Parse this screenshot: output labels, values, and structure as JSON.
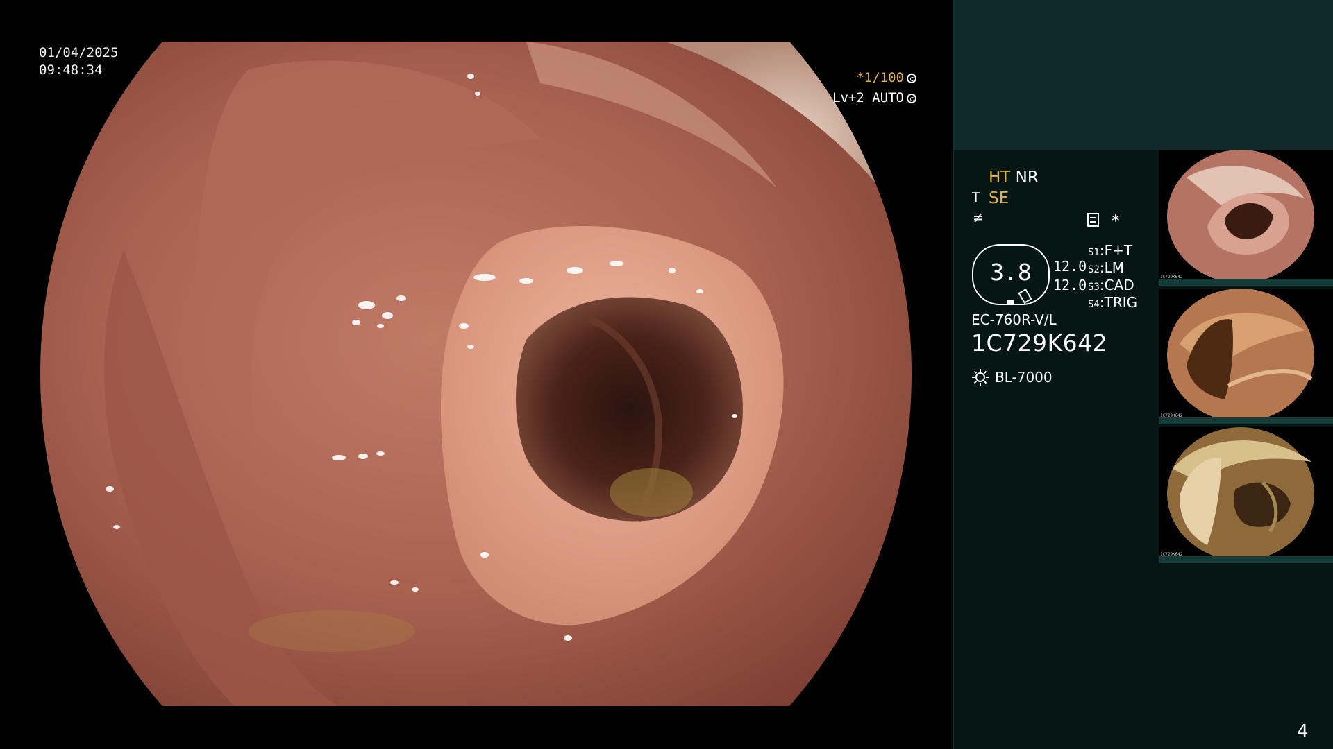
{
  "overlay": {
    "date": "01/04/2025",
    "time": "09:48:34",
    "shutter": "*1/100",
    "exposure_level": "Lv+2 AUTO"
  },
  "processing": {
    "ht": "HT",
    "nr": "NR",
    "se": "SE",
    "asterisk": "*"
  },
  "gauge": {
    "value": "3.8",
    "gain_top": "12.0",
    "gain_bottom": "12.0"
  },
  "switches": [
    {
      "key": "S1",
      "value": "F+T"
    },
    {
      "key": "S2",
      "value": "LM"
    },
    {
      "key": "S3",
      "value": "CAD"
    },
    {
      "key": "S4",
      "value": "TRIG"
    }
  ],
  "scope": {
    "model": "EC-760R-V/L",
    "serial": "1C729K642",
    "light_source": "BL-7000"
  },
  "thumbnails": [
    {
      "label": "1C729K642",
      "tone": "light"
    },
    {
      "label": "1C729K642",
      "tone": "mid"
    },
    {
      "label": "1C729K642",
      "tone": "yellow"
    }
  ],
  "page_number": "4",
  "colors": {
    "accent_orange": "#e5b040",
    "panel_top": "#0e2b2a",
    "panel_body": "#061615",
    "mucosa": "#b87260"
  },
  "icons": {
    "gauge": "lens-gauge-icon",
    "light": "sun-icon",
    "settings": "document-list-icon"
  }
}
